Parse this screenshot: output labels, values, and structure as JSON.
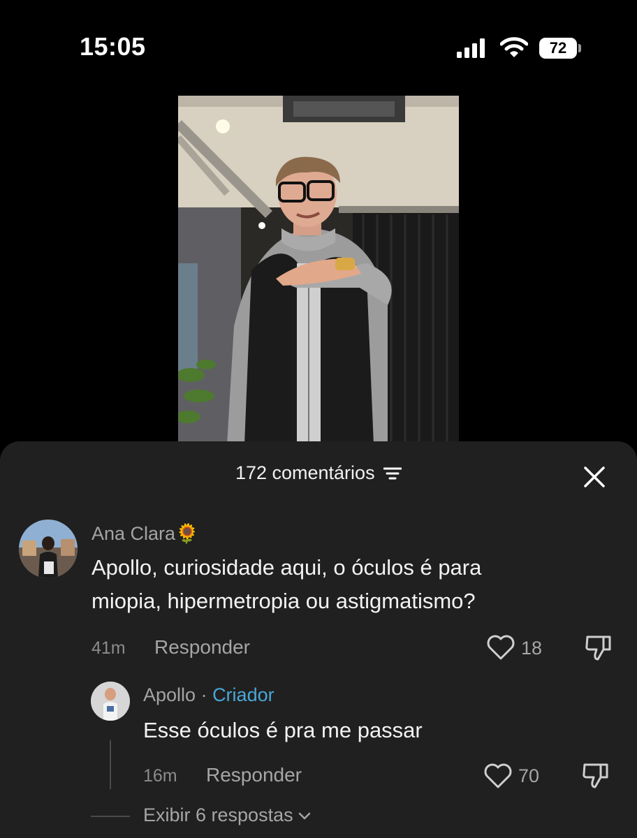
{
  "status_bar": {
    "time": "15:05",
    "battery_level": "72"
  },
  "video": {
    "icon": "video-frame"
  },
  "comments_sheet": {
    "count_label": "172 comentários",
    "comments": [
      {
        "username": "Ana Clara🌻",
        "text_line1": "Apollo, curiosidade aqui, o óculos é para",
        "text_line2": "miopia, hipermetropia ou astigmatismo?",
        "time": "41m",
        "reply_label": "Responder",
        "likes": "18"
      }
    ],
    "reply": {
      "username": "Apollo",
      "separator": " · ",
      "badge": "Criador",
      "text": "Esse óculos é pra me passar",
      "time": "16m",
      "reply_label": "Responder",
      "likes": "70"
    },
    "more_replies_label": "Exibir 6 respostas"
  },
  "colors": {
    "sheet_bg": "#202020",
    "creator_badge": "#4aa7d8"
  }
}
